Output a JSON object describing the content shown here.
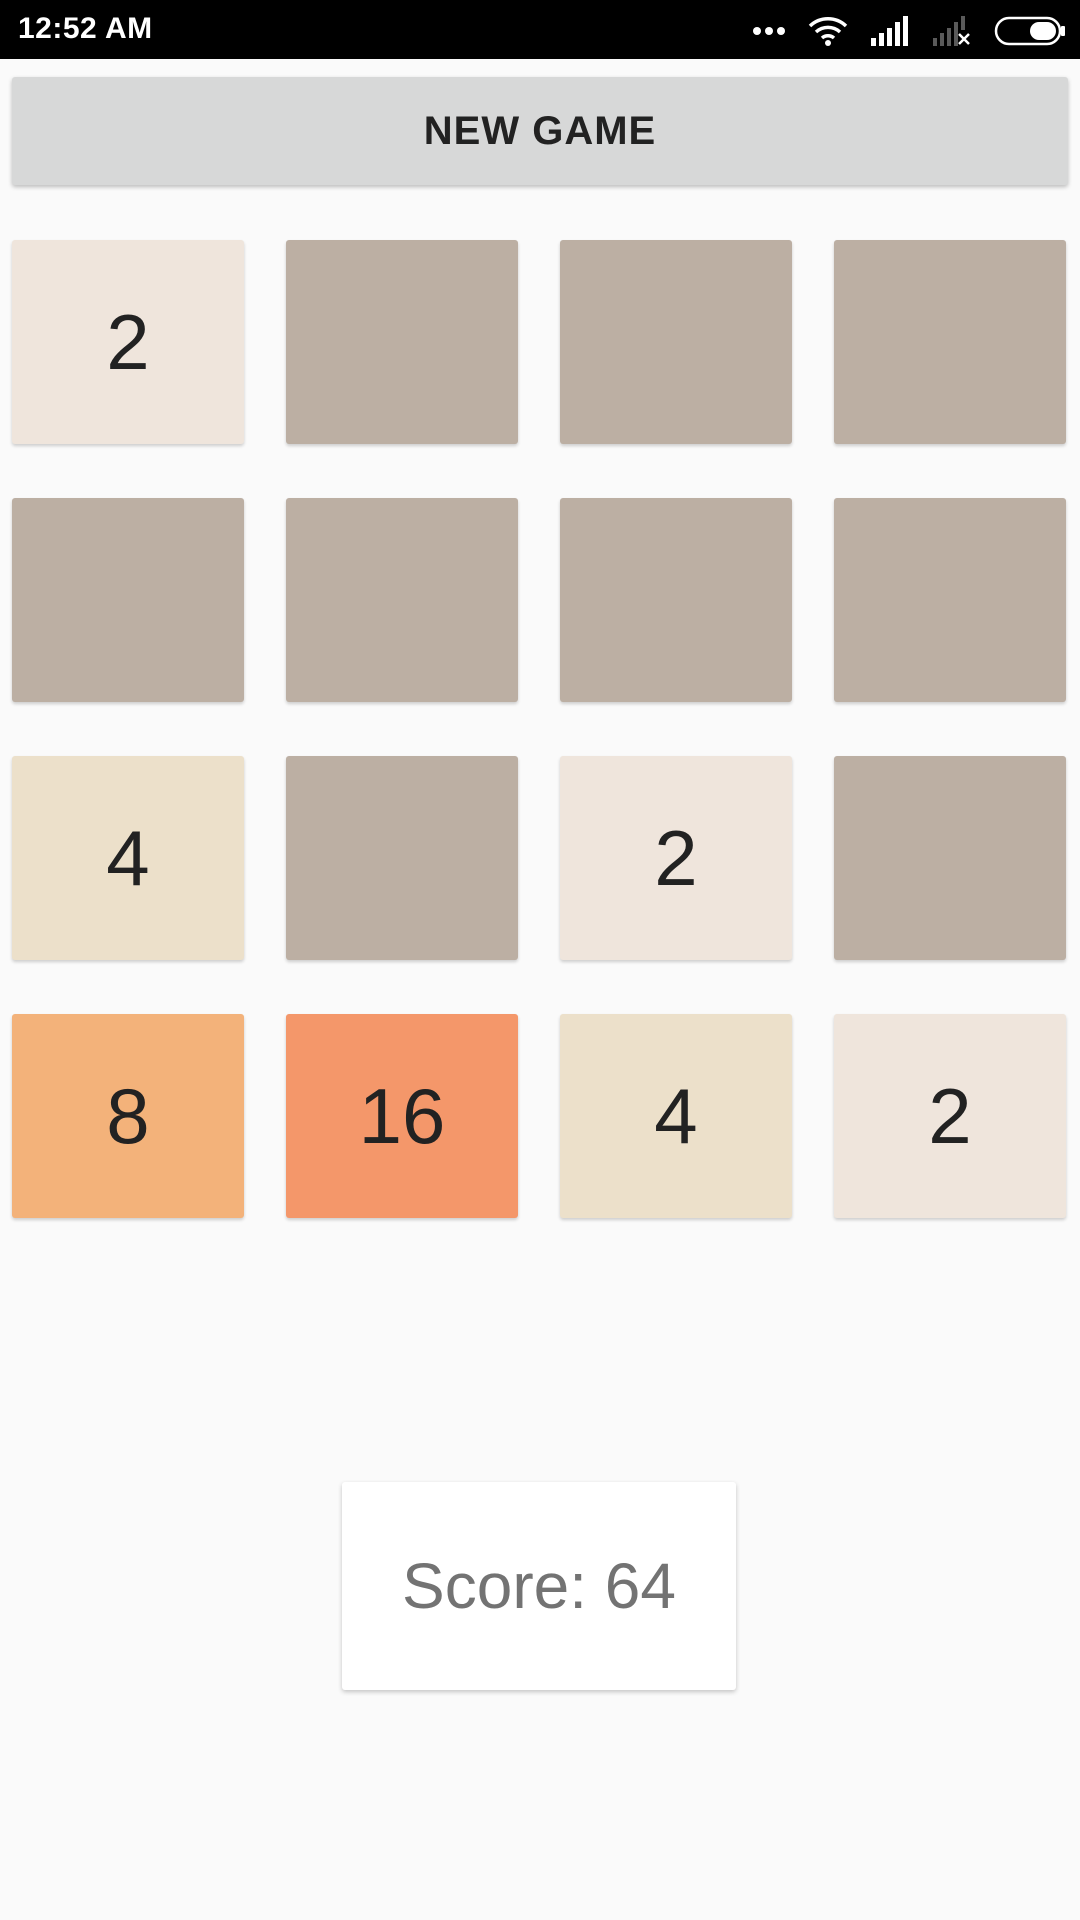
{
  "status_bar": {
    "time": "12:52 AM",
    "icons": [
      "more-dots-icon",
      "wifi-icon",
      "signal-icon",
      "signal-no-service-icon",
      "battery-icon"
    ]
  },
  "new_game_label": "NEW GAME",
  "board": {
    "rows": [
      [
        "2",
        "",
        "",
        ""
      ],
      [
        "",
        "",
        "",
        ""
      ],
      [
        "4",
        "",
        "2",
        ""
      ],
      [
        "8",
        "16",
        "4",
        "2"
      ]
    ],
    "colors": {
      "empty": "#bcafa3",
      "2": "#efe5dc",
      "4": "#ece0ca",
      "8": "#f3b27a",
      "16": "#f4976a"
    }
  },
  "score_text": "Score: 64"
}
